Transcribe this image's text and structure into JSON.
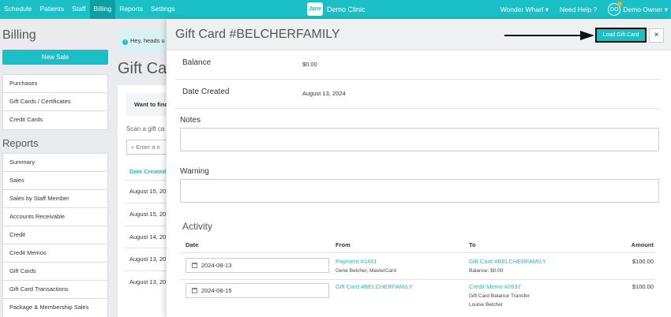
{
  "topnav": {
    "items": [
      "Schedule",
      "Patients",
      "Staff",
      "Billing",
      "Reports",
      "Settings"
    ],
    "active": "Billing",
    "brand_logo": "Jane",
    "brand_name": "Demo Clinic",
    "location": "Wonder Wharf",
    "help": "Need Help",
    "avatar_initials": "DO",
    "user": "Demo Owner",
    "accent_color": "#1bbfc6"
  },
  "sidebar": {
    "title": "Billing",
    "new_sale": "New Sale",
    "billing_items": [
      "Purchases",
      "Gift Cards / Certificates",
      "Credit Cards"
    ],
    "reports_title": "Reports",
    "report_items": [
      "Summary",
      "Sales",
      "Sales by Staff Member",
      "Accounts Receivable",
      "Credit",
      "Credit Memos",
      "Gift Cards",
      "Gift Card Transactions",
      "Package & Membership Sales"
    ]
  },
  "background": {
    "notice": "Hey, heads u",
    "title": "Gift Card",
    "want": "Want to find",
    "scan": "Scan a gift ca",
    "search_placeholder": "Enter a n",
    "date_header": "Date Created",
    "dates": [
      "August 15, 20",
      "August 15, 20",
      "August 14, 20",
      "August 13, 20",
      "August 13, 20"
    ]
  },
  "modal": {
    "title": "Gift Card #BELCHERFAMILY",
    "load_button": "Load Gift Card",
    "close": "×",
    "balance_label": "Balance",
    "balance_value": "$0.00",
    "created_label": "Date Created",
    "created_value": "August 13, 2024",
    "notes_label": "Notes",
    "warning_label": "Warning",
    "activity_title": "Activity",
    "columns": [
      "Date",
      "From",
      "To",
      "Amount"
    ],
    "rows": [
      {
        "date": "2024-08-13",
        "from_link": "Payment #1461",
        "from_detail": "Gene Belcher, MasterCard",
        "to_link": "Gift Card #BELCHERFAMILY",
        "to_detail": "Balance: $0.00",
        "to_detail2": "",
        "amount": "$100.00"
      },
      {
        "date": "2024-08-15",
        "from_link": "Gift Card #BELCHERFAMILY",
        "from_detail": "",
        "to_link": "Credit Memo #2637",
        "to_detail": "Gift Card Balance Transfer",
        "to_detail2": "Louise Belcher",
        "amount": "$100.00"
      }
    ]
  }
}
